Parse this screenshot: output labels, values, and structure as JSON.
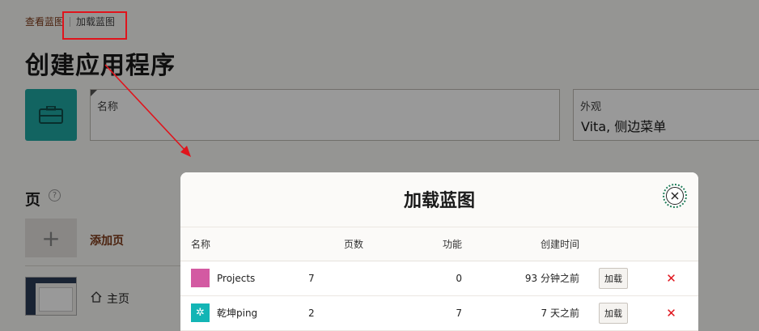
{
  "breadcrumb": {
    "link": "查看蓝图",
    "current": "加载蓝图"
  },
  "page": {
    "title": "创建应用程序",
    "name_label": "名称",
    "appearance_label": "外观",
    "appearance_value": "Vita, 侧边菜单",
    "pages_heading": "页",
    "help_icon": "?",
    "add_page_label": "添加页",
    "home_page_label": "主页"
  },
  "modal": {
    "title": "加载蓝图",
    "columns": {
      "name": "名称",
      "pages": "页数",
      "features": "功能",
      "created": "创建时间"
    },
    "rows": [
      {
        "name": "Projects",
        "pages": "7",
        "features": "0",
        "created": "93 分钟之前",
        "load": "加载",
        "color": "#d35aa2",
        "icon": "blank-swatch"
      },
      {
        "name": "乾坤ping",
        "pages": "2",
        "features": "7",
        "created": "7 天之前",
        "load": "加载",
        "color": "#13b5b5",
        "icon": "gear-icon"
      }
    ]
  },
  "colors": {
    "accent_link": "#7e3a18",
    "annotation_red": "#e0141c",
    "app_icon_teal": "#1fa7a2"
  }
}
